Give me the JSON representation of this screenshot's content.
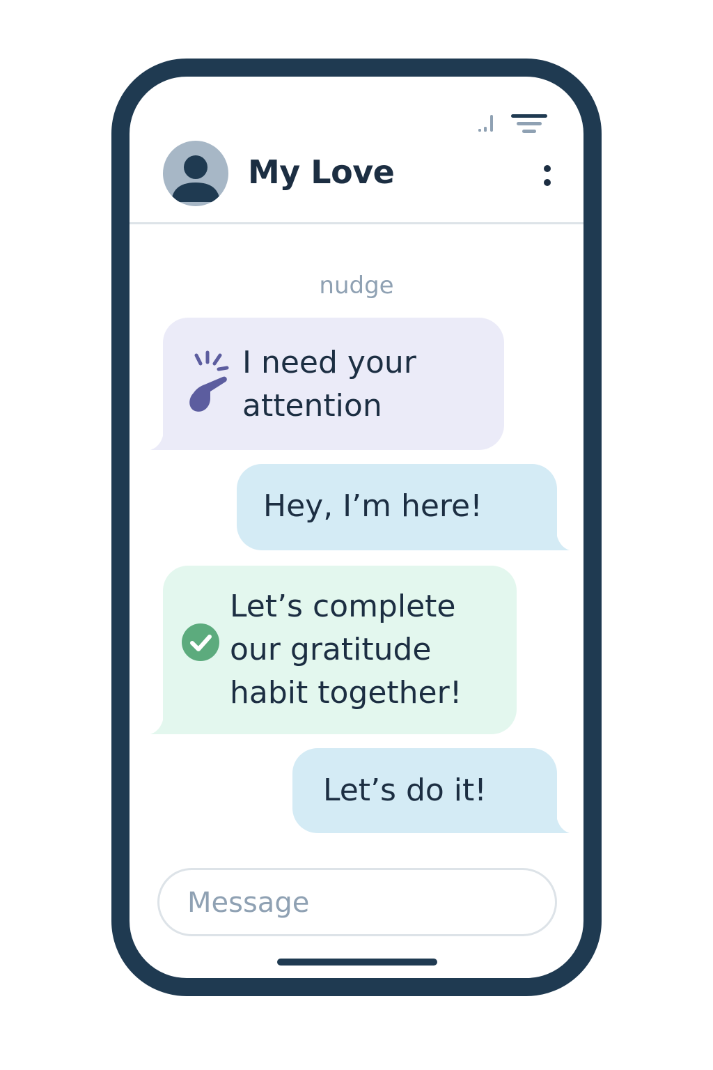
{
  "status_bar": {
    "signal_icon": "signal-icon",
    "wifi_icon": "wifi-icon"
  },
  "header": {
    "avatar_icon": "user-avatar-icon",
    "contact_name": "My Love",
    "menu_icon": "more-vertical-icon"
  },
  "conversation": {
    "nudge_label": "nudge",
    "messages": [
      {
        "direction": "incoming",
        "icon": "nudge-tap-icon",
        "text": "I need your attention",
        "color": "#ebebf8"
      },
      {
        "direction": "outgoing",
        "text": "Hey, I’m here!",
        "color": "#d4ebf5"
      },
      {
        "direction": "incoming",
        "icon": "check-circle-icon",
        "text": "Let’s complete our gratitude habit together!",
        "color": "#e3f7ee"
      },
      {
        "direction": "outgoing",
        "text": "Let’s do it!",
        "color": "#d4ebf5"
      }
    ]
  },
  "composer": {
    "placeholder": "Message",
    "value": ""
  },
  "colors": {
    "frame": "#1f3a51",
    "text": "#1c2e42",
    "muted": "#8fa1b3",
    "accent_green": "#5cab7d",
    "accent_purple": "#5c5d9f"
  }
}
